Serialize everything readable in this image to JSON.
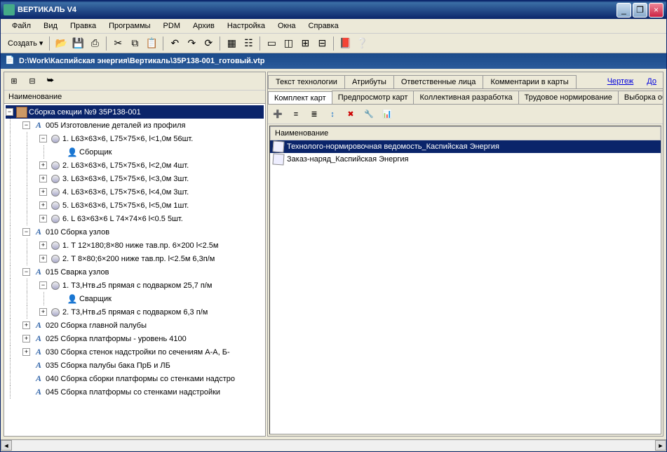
{
  "window": {
    "title": "ВЕРТИКАЛЬ V4"
  },
  "menu": [
    "Файл",
    "Вид",
    "Правка",
    "Программы",
    "PDM",
    "Архив",
    "Настройка",
    "Окна",
    "Справка"
  ],
  "toolbar": {
    "create": "Создать"
  },
  "path": "D:\\Work\\Каспийская энергия\\Вертикаль\\35Р138-001_готовый.vtp",
  "left": {
    "header": "Наименование",
    "tree": [
      {
        "d": 0,
        "exp": "-",
        "ico": "box",
        "t": "Сборка секции №9 35Р138-001",
        "sel": true
      },
      {
        "d": 1,
        "exp": "-",
        "ico": "a",
        "t": "005 Изготовление деталей из профиля"
      },
      {
        "d": 2,
        "exp": "-",
        "ico": "op",
        "t": "1. L63×63×6, L75×75×6, l<1,0м   56шт."
      },
      {
        "d": 3,
        "exp": "",
        "ico": "person",
        "t": "Сборщик"
      },
      {
        "d": 2,
        "exp": "+",
        "ico": "op",
        "t": "2. L63×63×6, L75×75×6, l<2,0м   4шт."
      },
      {
        "d": 2,
        "exp": "+",
        "ico": "op",
        "t": "3. L63×63×6, L75×75×6, l<3,0м   3шт."
      },
      {
        "d": 2,
        "exp": "+",
        "ico": "op",
        "t": "4. L63×63×6, L75×75×6, l<4,0м   3шт."
      },
      {
        "d": 2,
        "exp": "+",
        "ico": "op",
        "t": "5. L63×63×6, L75×75×6, l<5,0м   1шт."
      },
      {
        "d": 2,
        "exp": "+",
        "ico": "op",
        "t": "6. L 63×63×6  L 74×74×6   l<0.5   5шт."
      },
      {
        "d": 1,
        "exp": "-",
        "ico": "a",
        "t": "010 Сборка узлов"
      },
      {
        "d": 2,
        "exp": "+",
        "ico": "op",
        "t": "1. Т 12×180;8×80     ниже тав.пр.  6×200 l<2.5м"
      },
      {
        "d": 2,
        "exp": "+",
        "ico": "op",
        "t": "2. Т 8×80;6×200       ниже тав.пр. l<2.5м  6,3п/м"
      },
      {
        "d": 1,
        "exp": "-",
        "ico": "a",
        "t": "015 Сварка узлов"
      },
      {
        "d": 2,
        "exp": "-",
        "ico": "op",
        "t": "1. Т3,Нтв⊿5 прямая с подварком    25,7 п/м"
      },
      {
        "d": 3,
        "exp": "",
        "ico": "person",
        "t": "Сварщик"
      },
      {
        "d": 2,
        "exp": "+",
        "ico": "op",
        "t": "2. Т3,Нтв⊿5 прямая с подварком    6,3 п/м"
      },
      {
        "d": 1,
        "exp": "+",
        "ico": "a",
        "t": "020 Сборка главной палубы"
      },
      {
        "d": 1,
        "exp": "+",
        "ico": "a",
        "t": "025 Сборка платформы - уровень 4100"
      },
      {
        "d": 1,
        "exp": "+",
        "ico": "a",
        "t": "030 Сборка стенок надстройки по сечениям А-А, Б-"
      },
      {
        "d": 1,
        "exp": "",
        "ico": "a",
        "t": "035 Сборка палубы бака ПрБ и ЛБ"
      },
      {
        "d": 1,
        "exp": "",
        "ico": "a",
        "t": "040 Сборка сборки платформы со стенками надстро"
      },
      {
        "d": 1,
        "exp": "",
        "ico": "a",
        "t": "045 Сборка платформы со стенками надстройки"
      }
    ]
  },
  "right": {
    "tabs1": [
      "Текст технологии",
      "Атрибуты",
      "Ответственные лица",
      "Комментарии в карты"
    ],
    "tabs1_links": [
      "Чертеж",
      "До"
    ],
    "tabs2": [
      "Комплект карт",
      "Предпросмотр карт",
      "Коллективная разработка",
      "Трудовое нормирование",
      "Выборка объ"
    ],
    "tabs2_active": 0,
    "header": "Наименование",
    "list": [
      {
        "t": "Технолого-нормировочная ведомость_Каспийская Энергия",
        "sel": true
      },
      {
        "t": "Заказ-наряд_Каспийская Энергия",
        "sel": false
      }
    ]
  }
}
